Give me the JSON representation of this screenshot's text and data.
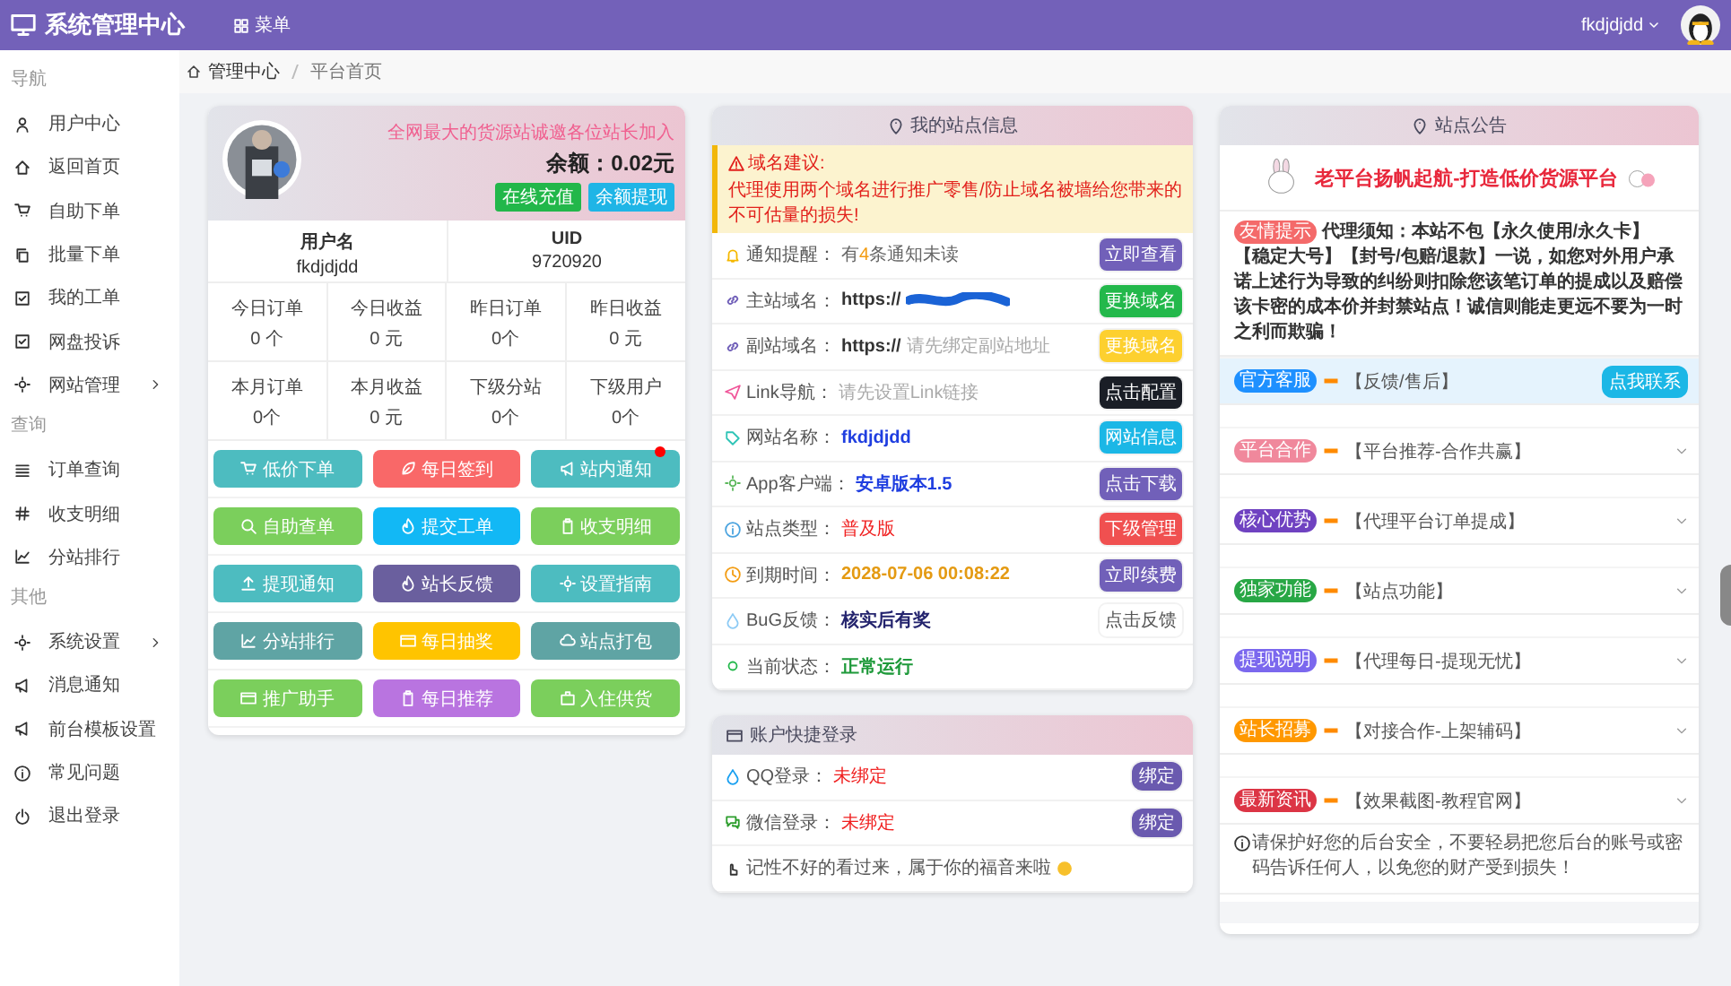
{
  "topbar": {
    "title": "系统管理中心",
    "menu": "菜单",
    "user": "fkdjdjdd"
  },
  "sidebar": [
    {
      "heading": "导航",
      "items": [
        {
          "label": "用户中心",
          "expandable": false
        },
        {
          "label": "返回首页",
          "expandable": false
        },
        {
          "label": "自助下单",
          "expandable": false
        },
        {
          "label": "批量下单",
          "expandable": false
        },
        {
          "label": "我的工单",
          "expandable": false
        },
        {
          "label": "网盘投诉",
          "expandable": false
        },
        {
          "label": "网站管理",
          "expandable": true
        }
      ]
    },
    {
      "heading": "查询",
      "items": [
        {
          "label": "订单查询",
          "expandable": false
        },
        {
          "label": "收支明细",
          "expandable": false
        },
        {
          "label": "分站排行",
          "expandable": false
        }
      ]
    },
    {
      "heading": "其他",
      "items": [
        {
          "label": "系统设置",
          "expandable": true
        },
        {
          "label": "消息通知",
          "expandable": false
        },
        {
          "label": "前台模板设置",
          "expandable": false
        },
        {
          "label": "常见问题",
          "expandable": false
        },
        {
          "label": "退出登录",
          "expandable": false
        }
      ]
    }
  ],
  "breadcrumb": [
    "管理中心",
    "平台首页"
  ],
  "profile": {
    "slogan": "全网最大的货源站诚邀各位站长加入",
    "balance": "余额：0.02元",
    "buttons": [
      {
        "label": "在线充值",
        "color": "#22b74a"
      },
      {
        "label": "余额提现",
        "color": "#1fb5e6"
      }
    ]
  },
  "account": [
    {
      "label": "用户名",
      "value": "fkdjdjdd"
    },
    {
      "label": "UID",
      "value": "9720920"
    }
  ],
  "stats": [
    {
      "label": "今日订单",
      "value": "0 个"
    },
    {
      "label": "今日收益",
      "value": "0 元"
    },
    {
      "label": "昨日订单",
      "value": "0个"
    },
    {
      "label": "昨日收益",
      "value": "0 元"
    },
    {
      "label": "本月订单",
      "value": "0个"
    },
    {
      "label": "本月收益",
      "value": "0 元"
    },
    {
      "label": "下级分站",
      "value": "0个"
    },
    {
      "label": "下级用户",
      "value": "0个"
    }
  ],
  "actions": [
    {
      "label": "低价下单",
      "color": "#4dbcc0",
      "badge": false
    },
    {
      "label": "每日签到",
      "color": "#f96868",
      "badge": false
    },
    {
      "label": "站内通知",
      "color": "#4dbcc0",
      "badge": true
    },
    {
      "label": "自助查单",
      "color": "#7bcf5c",
      "badge": false
    },
    {
      "label": "提交工单",
      "color": "#12b8f5",
      "badge": false
    },
    {
      "label": "收支明细",
      "color": "#7bcf5c",
      "badge": false
    },
    {
      "label": "提现通知",
      "color": "#4dbcc0",
      "badge": false
    },
    {
      "label": "站长反馈",
      "color": "#6a5f9e",
      "badge": false
    },
    {
      "label": "设置指南",
      "color": "#4dbcc0",
      "badge": false
    },
    {
      "label": "分站排行",
      "color": "#5fa4a4",
      "badge": false
    },
    {
      "label": "每日抽奖",
      "color": "#ffc400",
      "badge": false
    },
    {
      "label": "站点打包",
      "color": "#5fa4a4",
      "badge": false
    },
    {
      "label": "推广助手",
      "color": "#7bcf5c",
      "badge": false
    },
    {
      "label": "每日推荐",
      "color": "#b974e0",
      "badge": false
    },
    {
      "label": "入住供货",
      "color": "#7bcf5c",
      "badge": false
    }
  ],
  "site_info": {
    "title": "我的站点信息",
    "warning": {
      "title": "域名建议:",
      "text": "代理使用两个域名进行推广零售/防止域名被墙给您带来的不可估量的损失!"
    },
    "rows": [
      {
        "label": "通知提醒：",
        "value": "有**4**条通知未读",
        "kind": "plain",
        "button": {
          "label": "立即查看",
          "color": "#7160b9"
        }
      },
      {
        "label": "主站域名：",
        "prefix": "https://",
        "kind": "redacted",
        "button": {
          "label": "更换域名",
          "color": "#23b84b"
        }
      },
      {
        "label": "副站域名：",
        "prefix": "https://",
        "value": "请先绑定副站地址",
        "kind": "hint",
        "button": {
          "label": "更换域名",
          "color": "#fdd02f"
        }
      },
      {
        "label": "Link导航：",
        "value": "请先设置Link链接",
        "kind": "hint",
        "button": {
          "label": "点击配置",
          "color": "#1a1e26"
        }
      },
      {
        "label": "网站名称：",
        "value": "fkdjdjdd",
        "kind": "link",
        "button": {
          "label": "网站信息",
          "color": "#1bb7e6"
        }
      },
      {
        "label": "App客户端：",
        "value": "安卓版本1.5",
        "kind": "link",
        "button": {
          "label": "点击下载",
          "color": "#7160b9"
        }
      },
      {
        "label": "站点类型：",
        "value": "普及版",
        "kind": "red",
        "button": {
          "label": "下级管理",
          "color": "#f05050"
        }
      },
      {
        "label": "到期时间：",
        "value": "2028-07-06 00:08:22",
        "kind": "orange",
        "button": {
          "label": "立即续费",
          "color": "#7160b9"
        }
      },
      {
        "label": "BuG反馈：",
        "value": "核实后有奖",
        "kind": "navy",
        "button": {
          "label": "点击反馈",
          "color": "#ffffff"
        }
      },
      {
        "label": "当前状态：",
        "value": "正常运行",
        "kind": "green"
      }
    ]
  },
  "quick_login": {
    "title": "账户快捷登录",
    "rows": [
      {
        "label": "QQ登录：",
        "value": "未绑定",
        "button": "绑定"
      },
      {
        "label": "微信登录：",
        "value": "未绑定",
        "button": "绑定"
      }
    ],
    "note": "记性不好的看过来，属于你的福音来啦"
  },
  "notice": {
    "title": "站点公告",
    "banner": "老平台扬帆起航-打造低价货源平台",
    "tip": {
      "tag": "友情提示",
      "text": "代理须知：本站不包【永久使用/永久卡】【稳定大号】【封号/包赔/退款】一说，如您对外用户承诺上述行为导致的纠纷则扣除您该笔订单的提成以及赔偿该卡密的成本价并封禁站点！诚信则能走更远不要为一时之利而欺骗！"
    },
    "items": [
      {
        "tag": "官方客服",
        "color": "#1e90ff",
        "text": "【反馈/售后】",
        "highlighted": true,
        "expandable": false,
        "action": "点我联系"
      },
      {
        "tag": "平台合作",
        "color": "#f0889c",
        "text": "【平台推荐-合作共赢】",
        "highlighted": false,
        "expandable": true
      },
      {
        "tag": "核心优势",
        "color": "#6f42c1",
        "text": "【代理平台订单提成】",
        "highlighted": false,
        "expandable": true
      },
      {
        "tag": "独家功能",
        "color": "#28a745",
        "text": "【站点功能】",
        "highlighted": false,
        "expandable": true
      },
      {
        "tag": "提现说明",
        "color": "#7b68ee",
        "text": "【代理每日-提现无忧】",
        "highlighted": false,
        "expandable": true
      },
      {
        "tag": "站长招募",
        "color": "#ff9800",
        "text": "【对接合作-上架辅码】",
        "highlighted": false,
        "expandable": true
      },
      {
        "tag": "最新资讯",
        "color": "#dc3545",
        "text": "【效果截图-教程官网】",
        "highlighted": false,
        "expandable": true
      }
    ],
    "footer": "请保护好您的后台安全，不要轻易把您后台的账号或密码告诉任何人，以免您的财产受到损失！"
  }
}
